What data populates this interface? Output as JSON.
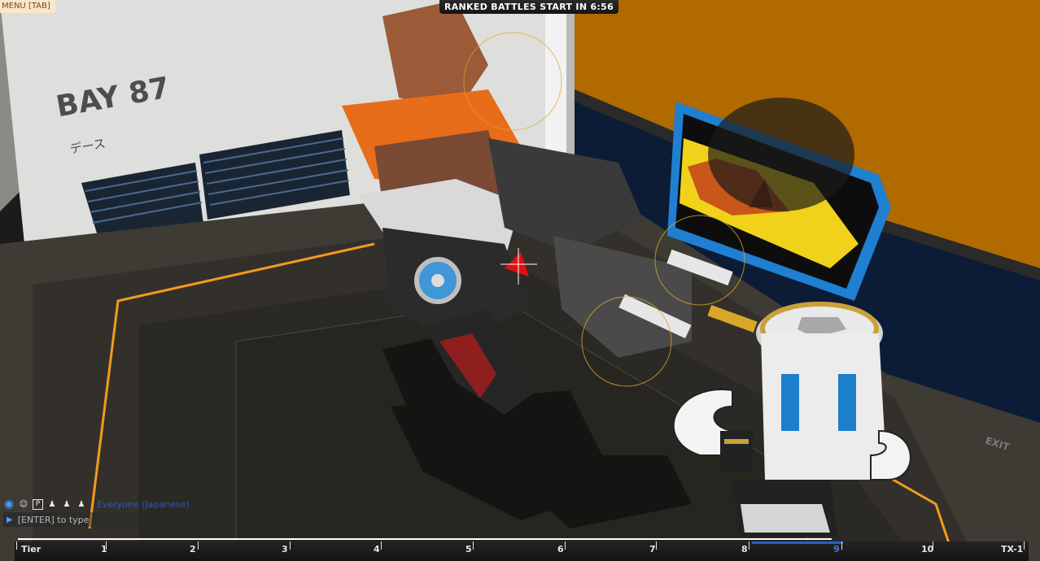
{
  "hud": {
    "menu_label": "MENU [TAB]",
    "ranked_text": "RANKED BATTLES START IN 6:56"
  },
  "bay": {
    "title": "BAY 87",
    "subtitle": "デース"
  },
  "chat": {
    "channel": "Everyone (Japanese)",
    "placeholder": "[ENTER] to type",
    "icons": [
      "globe-icon",
      "person-icon",
      "party-icon",
      "friend-1-icon",
      "friend-2-icon",
      "friend-3-icon"
    ]
  },
  "tier_bar": {
    "labels": [
      "Tier",
      "1",
      "2",
      "3",
      "4",
      "5",
      "6",
      "7",
      "8",
      "9",
      "10",
      "TX-1"
    ],
    "current": "9",
    "accent_color": "#2d5fbf"
  },
  "colors": {
    "back_wall_orange": "#b06a00",
    "bay_wall": "#dadbd8",
    "floor_trim": "#f39a1c",
    "screen_frame": "#1f7fd0"
  }
}
